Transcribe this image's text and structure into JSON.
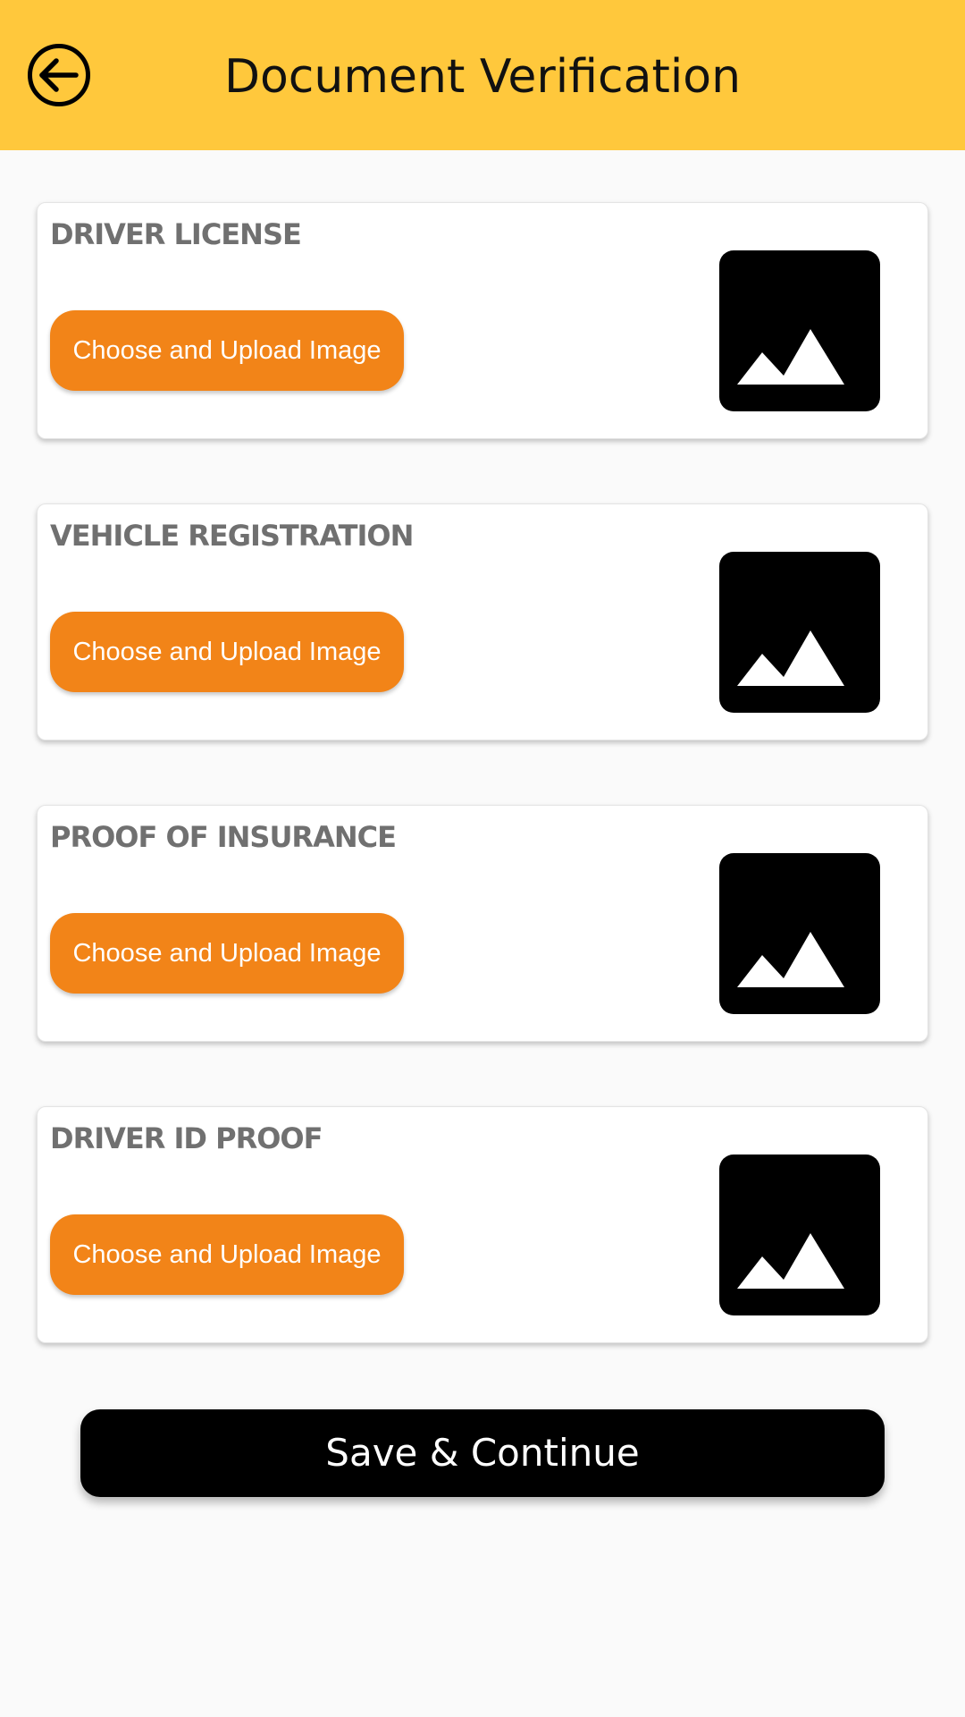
{
  "header": {
    "title": "Document Verification",
    "back_icon": "arrow-left-circle-icon",
    "background_color": "#ffc83c"
  },
  "documents": [
    {
      "title": "Driver License",
      "button_label": "Choose and Upload Image",
      "preview_icon": "image-placeholder-icon"
    },
    {
      "title": "Vehicle Registration",
      "button_label": "Choose and Upload Image",
      "preview_icon": "image-placeholder-icon"
    },
    {
      "title": "Proof of Insurance",
      "button_label": "Choose and Upload Image",
      "preview_icon": "image-placeholder-icon"
    },
    {
      "title": "Driver ID Proof",
      "button_label": "Choose and Upload Image",
      "preview_icon": "image-placeholder-icon"
    }
  ],
  "footer": {
    "save_label": "Save & Continue"
  },
  "colors": {
    "accent": "#f28418",
    "primary_button": "#000000",
    "title_text": "#707070"
  }
}
